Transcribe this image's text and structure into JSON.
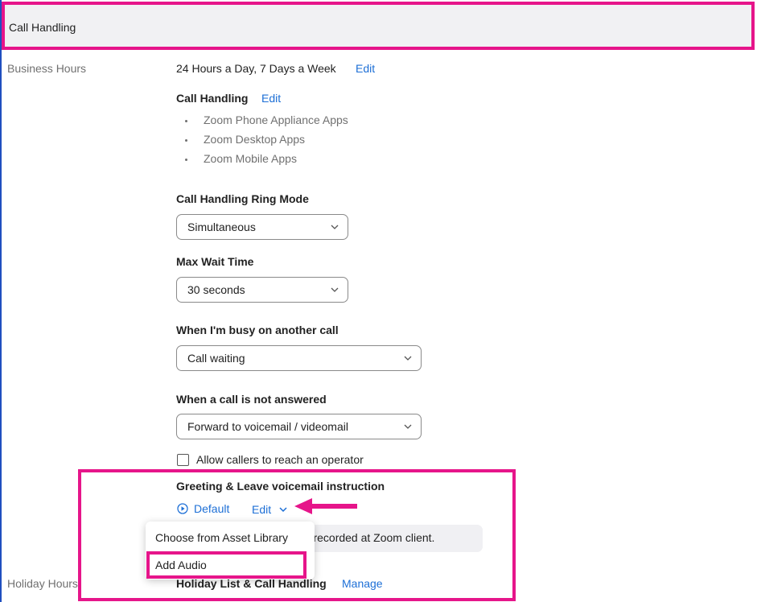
{
  "header": {
    "title": "Call Handling"
  },
  "business_hours": {
    "label": "Business Hours",
    "schedule": "24 Hours a Day, 7 Days a Week",
    "edit_label": "Edit",
    "call_handling": {
      "title": "Call Handling",
      "edit_label": "Edit",
      "apps": [
        "Zoom Phone Appliance Apps",
        "Zoom Desktop Apps",
        "Zoom Mobile Apps"
      ]
    },
    "ring_mode": {
      "label": "Call Handling Ring Mode",
      "value": "Simultaneous"
    },
    "max_wait": {
      "label": "Max Wait Time",
      "value": "30 seconds"
    },
    "busy": {
      "label": "When I'm busy on another call",
      "value": "Call waiting"
    },
    "not_answered": {
      "label": "When a call is not answered",
      "value": "Forward to voicemail / videomail"
    },
    "operator": {
      "label": "Allow callers to reach an operator",
      "checked": false
    },
    "greeting": {
      "title": "Greeting & Leave voicemail instruction",
      "default_label": "Default",
      "edit_label": "Edit",
      "note": "be recorded at Zoom client."
    }
  },
  "dropdown_menu": {
    "items": [
      "Choose from Asset Library",
      "Add Audio"
    ]
  },
  "holiday_hours": {
    "label": "Holiday Hours",
    "title": "Holiday List & Call Handling",
    "manage_label": "Manage"
  },
  "colors": {
    "highlight": "#e6158a",
    "link": "#1d6fd6",
    "left_border": "#1f4fbf"
  }
}
